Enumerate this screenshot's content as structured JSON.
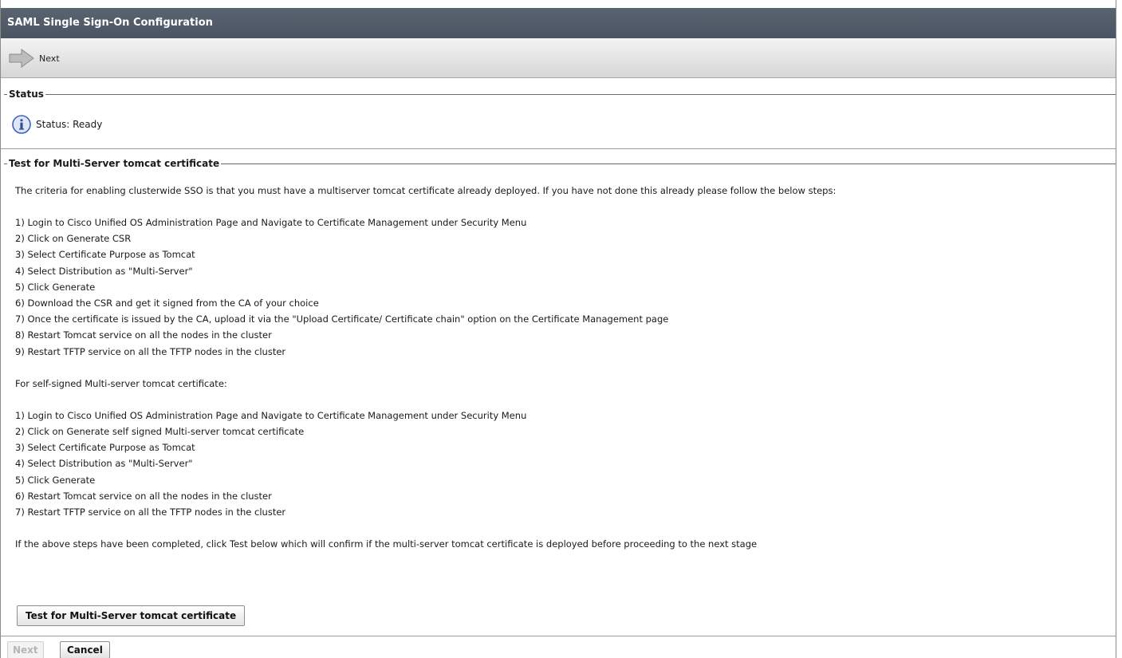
{
  "window": {
    "title": "SAML Single Sign-On Configuration"
  },
  "toolbar": {
    "next_label": "Next",
    "next_icon": "arrow-right-icon"
  },
  "status": {
    "legend": "Status",
    "icon": "info-icon",
    "text": "Status: Ready"
  },
  "test_section": {
    "legend": "Test for Multi-Server tomcat certificate",
    "intro": "The criteria for enabling clusterwide SSO is that you must have a multiserver tomcat certificate already deployed. If you have not done this already please follow the below steps:",
    "ca_steps": [
      "1) Login to Cisco Unified OS Administration Page and Navigate to Certificate Management under Security Menu",
      "2) Click on Generate CSR",
      "3) Select Certificate Purpose as Tomcat",
      "4) Select Distribution as \"Multi-Server\"",
      "5) Click Generate",
      "6) Download the CSR and get it signed from the CA of your choice",
      "7) Once the certificate is issued by the CA, upload it via the \"Upload Certificate/ Certificate chain\" option on the Certificate Management page",
      "8) Restart Tomcat service on all the nodes in the cluster",
      "9) Restart TFTP service on all the TFTP nodes in the cluster"
    ],
    "self_signed_heading": "For self-signed Multi-server tomcat certificate:",
    "self_signed_steps": [
      "1) Login to Cisco Unified OS Administration Page and Navigate to Certificate Management under Security Menu",
      "2) Click on Generate self signed Multi-server tomcat certificate",
      "3) Select Certificate Purpose as Tomcat",
      "4) Select Distribution as \"Multi-Server\"",
      "5) Click Generate",
      "6) Restart Tomcat service on all the nodes in the cluster",
      "7) Restart TFTP service on all the TFTP nodes in the cluster"
    ],
    "outro": "If the above steps have been completed, click Test below which will confirm if the multi-server tomcat certificate is deployed before proceeding to the next stage",
    "test_button_label": "Test for Multi-Server tomcat certificate"
  },
  "footer": {
    "next_label": "Next",
    "cancel_label": "Cancel"
  },
  "colors": {
    "titlebar": "#4f5866",
    "toolbar": "#e2e2e2",
    "info_icon": "#3a64b8"
  }
}
